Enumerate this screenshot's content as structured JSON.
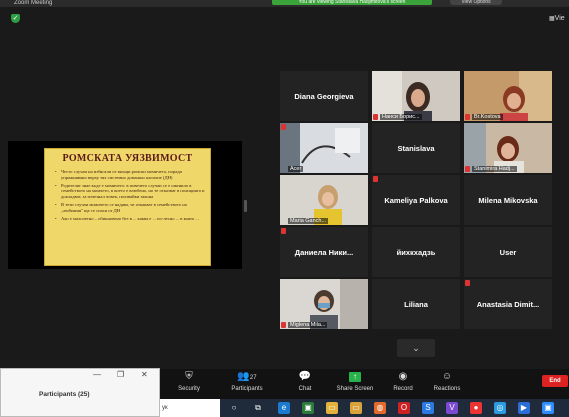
{
  "window": {
    "title": "Zoom Meeting"
  },
  "banner": {
    "text": "You are viewing Stanislava Hadjimitova's screen",
    "view_options": "View Options"
  },
  "top_right": {
    "view_label": "Vie"
  },
  "slide": {
    "title": "РОМСКАТА УЯЗВИМОСТ",
    "bullets": [
      "Често случаи на избягали от вкъщи ромски момичета, поради упражнявано върху тях системно домашно насилие (ДН)",
      "Родителят знае къде е момичето: в повечето случаи се е оженило в семейството на момчето, в което е влюбено, но те отказват в полицията и докладват, за изчезнал човек, ползвайки закона",
      "В тези случаи момичето се надява, че откакват в семейството на „любимия\" ще се спаси от ДН",
      "Ако е малолетно – обикновено без в ... каква е ... по-лесно ... в която ..."
    ]
  },
  "participants_tiles": [
    {
      "name": "Diana Georgieva",
      "label": "",
      "video": false,
      "muted": false
    },
    {
      "name": "",
      "label": "Нанси Борис...",
      "video": true,
      "muted": true
    },
    {
      "name": "",
      "label": "Br.Kostova",
      "video": true,
      "muted": true
    },
    {
      "name": "",
      "label": "Acer",
      "video": true,
      "muted": true
    },
    {
      "name": "Stanislava",
      "label": "",
      "video": false,
      "muted": false
    },
    {
      "name": "",
      "label": "Stanimira Hadj...",
      "video": true,
      "muted": true,
      "highlight": true
    },
    {
      "name": "",
      "label": "Maria Ganch...",
      "video": true,
      "muted": true
    },
    {
      "name": "Kameliya Palkova",
      "label": "",
      "video": false,
      "muted": true
    },
    {
      "name": "Milena Mikovska",
      "label": "",
      "video": false,
      "muted": false
    },
    {
      "name": "Даниела Ники...",
      "label": "",
      "video": false,
      "muted": true
    },
    {
      "name": "йихкхадзь",
      "label": "",
      "video": false,
      "muted": false
    },
    {
      "name": "User",
      "label": "",
      "video": false,
      "muted": false
    },
    {
      "name": "",
      "label": "Miglena Mila...",
      "video": true,
      "muted": true
    },
    {
      "name": "Liliana",
      "label": "",
      "video": false,
      "muted": false
    },
    {
      "name": "Anastasia Dimit...",
      "label": "",
      "video": false,
      "muted": true
    }
  ],
  "toolbar": {
    "security": "Security",
    "participants": "Participants",
    "participants_count": "27",
    "chat": "Chat",
    "share_screen": "Share Screen",
    "record": "Record",
    "reactions": "Reactions",
    "end": "End"
  },
  "participants_panel": {
    "title": "Participants (25)"
  },
  "taskbar": {
    "search_fragment": "ук"
  },
  "colors": {
    "highlight": "#b9d547",
    "share_green": "#28b24b",
    "end_red": "#d22222",
    "mute_red": "#d33333"
  }
}
